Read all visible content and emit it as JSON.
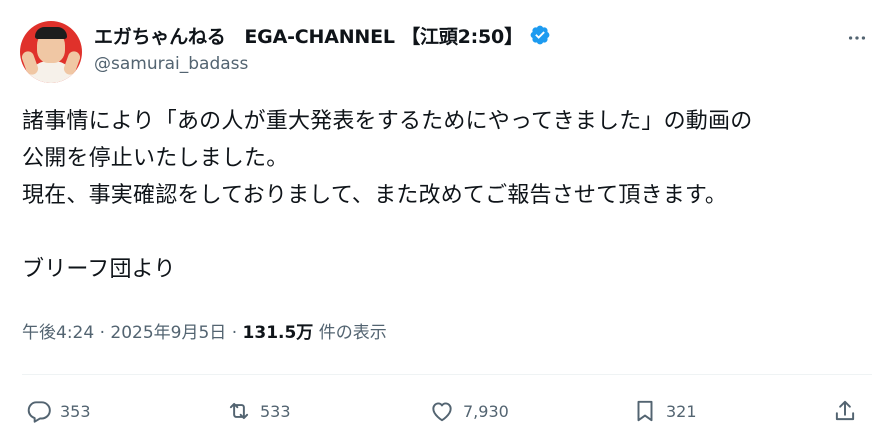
{
  "author": {
    "display_name": "エガちゃんねる　EGA-CHANNEL 【江頭2:50】",
    "handle": "@samurai_badass",
    "verified_color": "#1d9bf0"
  },
  "tweet": {
    "lines": [
      "諸事情により「あの人が重大発表をするためにやってきました」の動画の",
      "公開を停止いたしました。",
      "現在、事実確認をしておりまして、また改めてご報告させて頂きます。",
      "",
      "ブリーフ団より"
    ]
  },
  "meta": {
    "time": "午後4:24",
    "sep1": " · ",
    "date": "2025年9月5日",
    "sep2": " · ",
    "views": "131.5万",
    "views_suffix": " 件の表示"
  },
  "actions": {
    "reply_count": "353",
    "retweet_count": "533",
    "like_count": "7,930",
    "bookmark_count": "321"
  },
  "icons": {
    "reply": "reply-icon",
    "retweet": "retweet-icon",
    "like": "heart-icon",
    "bookmark": "bookmark-icon",
    "share": "share-icon",
    "more": "more-icon"
  }
}
